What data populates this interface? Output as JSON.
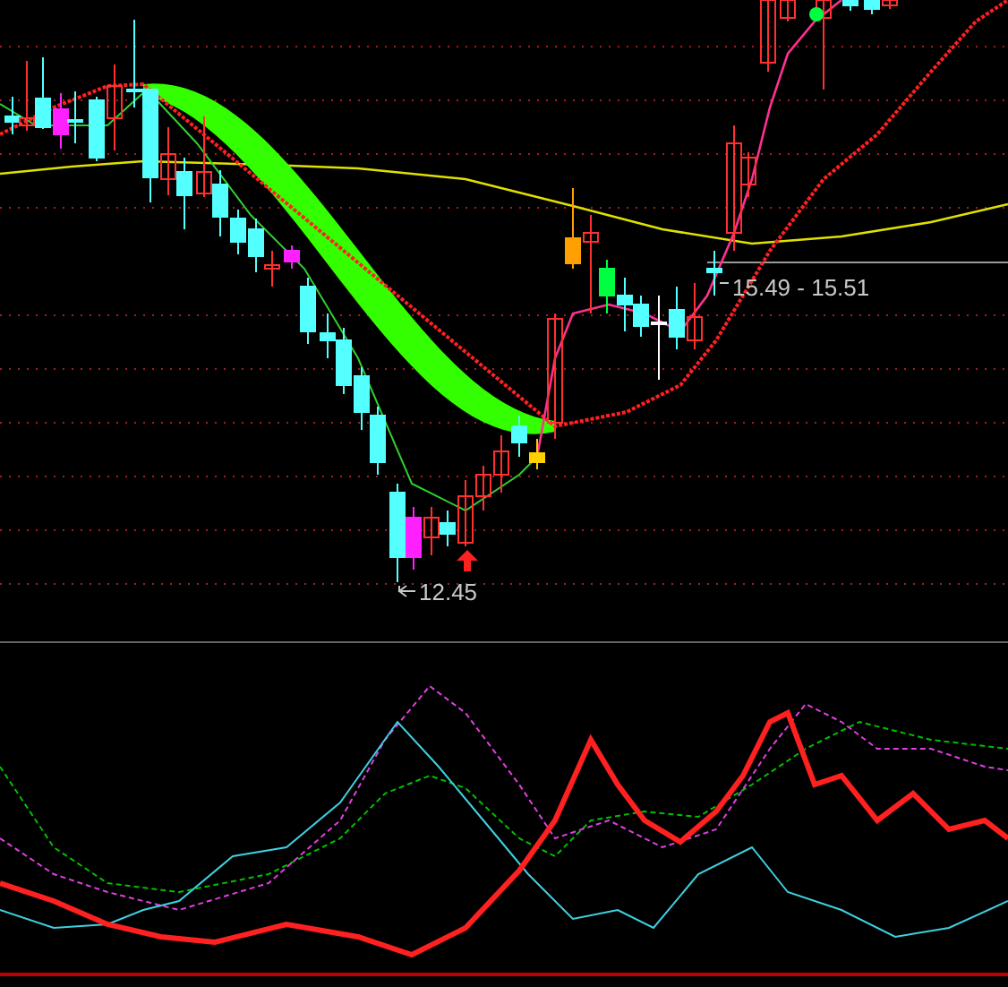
{
  "price_panel": {
    "low_label": "12.45",
    "range_label": "15.49 - 15.51"
  }
}
